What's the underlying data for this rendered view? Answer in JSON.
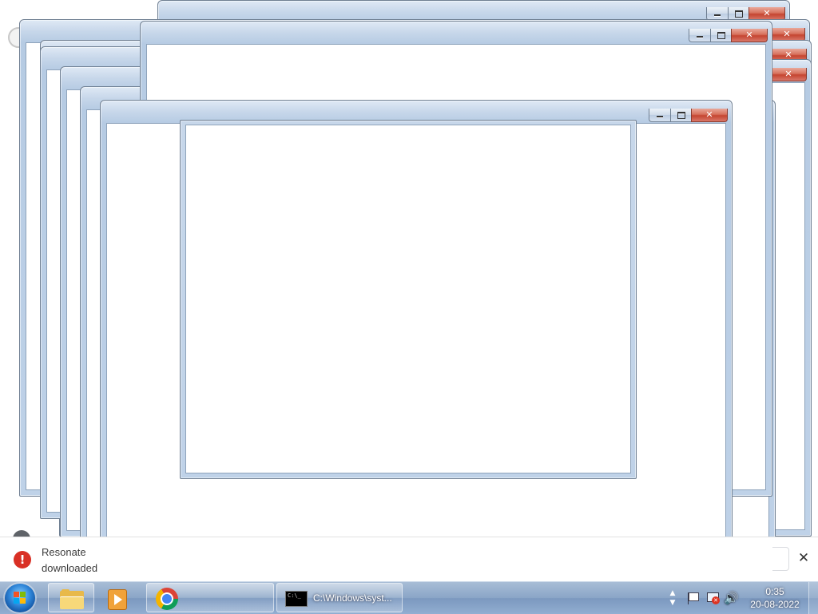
{
  "download_bar": {
    "line1": "Resonate",
    "line2": "downloaded",
    "close_symbol": "✕"
  },
  "windows": [
    {
      "id": "window-1"
    },
    {
      "id": "window-2"
    },
    {
      "id": "window-3"
    },
    {
      "id": "window-4"
    },
    {
      "id": "window-5"
    },
    {
      "id": "window-6"
    },
    {
      "id": "window-7"
    },
    {
      "id": "window-8"
    }
  ],
  "taskbar": {
    "start_icon": "windows-start-orb",
    "items": [
      {
        "icon": "folder-icon",
        "label": ""
      },
      {
        "icon": "media-player-icon",
        "label": ""
      },
      {
        "icon": "chrome-icon",
        "label": ""
      },
      {
        "icon": "cmd-icon",
        "label": "C:\\Windows\\syst..."
      }
    ],
    "cmd_icon_text": "C:\\_",
    "tray": {
      "icons": [
        "show-hidden-icons-icon",
        "action-center-flag-icon",
        "network-error-icon",
        "volume-icon"
      ],
      "time": "0:35",
      "date": "20-08-2022"
    }
  }
}
